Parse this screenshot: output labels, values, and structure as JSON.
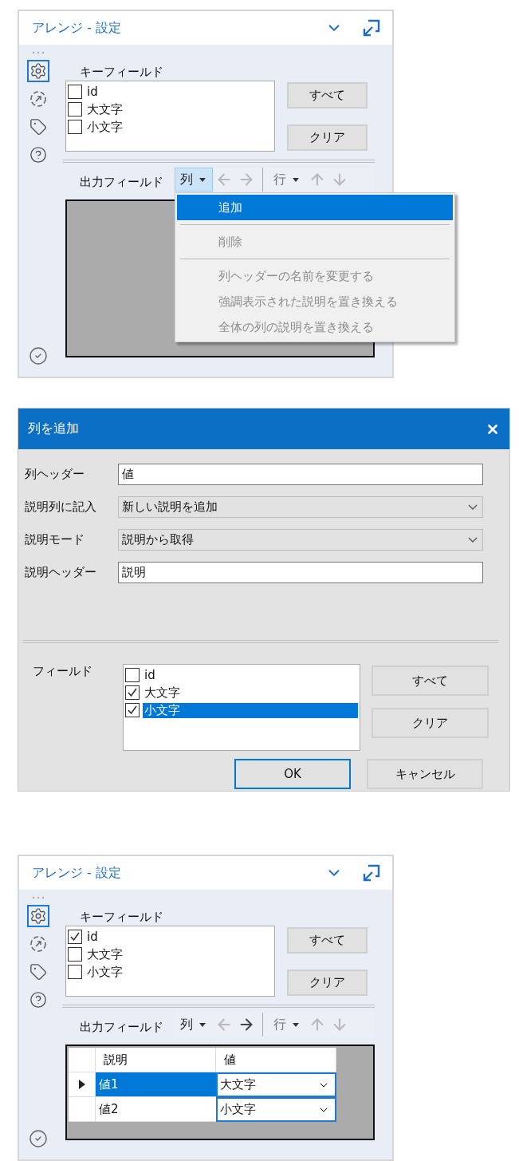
{
  "panel_top": {
    "title": "アレンジ - 設定",
    "sidebar": [
      {
        "kind": "gear",
        "selected": true
      },
      {
        "kind": "target",
        "selected": false
      },
      {
        "kind": "tag",
        "selected": false
      },
      {
        "kind": "help",
        "selected": false
      }
    ],
    "key_field_label": "キーフィールド",
    "key_fields": [
      {
        "label": "id",
        "checked": false
      },
      {
        "label": "大文字",
        "checked": false
      },
      {
        "label": "小文字",
        "checked": false
      }
    ],
    "buttons": [
      "すべて",
      "クリア"
    ],
    "output_label": "出力フィールド",
    "toolbar": {
      "column_label": "列",
      "column_open": true,
      "row_label": "行",
      "arrows": [
        {
          "kind": "left",
          "disabled": true
        },
        {
          "kind": "right",
          "disabled": true
        },
        {
          "kind": "up",
          "disabled": true
        },
        {
          "kind": "down",
          "disabled": true
        }
      ]
    },
    "menu": [
      {
        "kind": "item",
        "label": "追加",
        "selected": true,
        "disabled": false
      },
      {
        "kind": "separator"
      },
      {
        "kind": "item",
        "label": "削除",
        "selected": false,
        "disabled": true
      },
      {
        "kind": "separator"
      },
      {
        "kind": "item",
        "label": "列ヘッダーの名前を変更する",
        "selected": false,
        "disabled": true
      },
      {
        "kind": "item",
        "label": "強調表示された説明を置き換える",
        "selected": false,
        "disabled": true
      },
      {
        "kind": "item",
        "label": "全体の列の説明を置き換える",
        "selected": false,
        "disabled": true
      }
    ]
  },
  "dialog": {
    "title": "列を追加",
    "rows": [
      {
        "kind": "text",
        "label": "列ヘッダー",
        "value": "値"
      },
      {
        "kind": "select",
        "label": "説明列に記入",
        "value": "新しい説明を追加"
      },
      {
        "kind": "select",
        "label": "説明モード",
        "value": "説明から取得"
      },
      {
        "kind": "text",
        "label": "説明ヘッダー",
        "value": "説明"
      }
    ],
    "fields_label": "フィールド",
    "fields": [
      {
        "label": "id",
        "checked": false,
        "selected": false
      },
      {
        "label": "大文字",
        "checked": true,
        "selected": false
      },
      {
        "label": "小文字",
        "checked": true,
        "selected": true
      }
    ],
    "side_buttons": [
      "すべて",
      "クリア"
    ],
    "footer_buttons": [
      {
        "label": "OK",
        "default": true
      },
      {
        "label": "キャンセル",
        "default": false
      }
    ]
  },
  "panel_bottom": {
    "title": "アレンジ - 設定",
    "sidebar": [
      {
        "kind": "gear",
        "selected": true
      },
      {
        "kind": "target",
        "selected": false
      },
      {
        "kind": "tag",
        "selected": false
      },
      {
        "kind": "help",
        "selected": false
      }
    ],
    "key_field_label": "キーフィールド",
    "key_fields": [
      {
        "label": "id",
        "checked": true
      },
      {
        "label": "大文字",
        "checked": false
      },
      {
        "label": "小文字",
        "checked": false
      }
    ],
    "buttons": [
      "すべて",
      "クリア"
    ],
    "output_label": "出力フィールド",
    "toolbar": {
      "column_label": "列",
      "column_open": false,
      "row_label": "行",
      "arrows": [
        {
          "kind": "left",
          "disabled": true
        },
        {
          "kind": "right",
          "disabled": false
        },
        {
          "kind": "up",
          "disabled": true
        },
        {
          "kind": "down",
          "disabled": true
        }
      ]
    },
    "table": {
      "columns": [
        "説明",
        "値"
      ],
      "rows": [
        {
          "label": "値1",
          "value": "大文字",
          "selected": true
        },
        {
          "label": "値2",
          "value": "小文字",
          "selected": false
        }
      ]
    }
  }
}
